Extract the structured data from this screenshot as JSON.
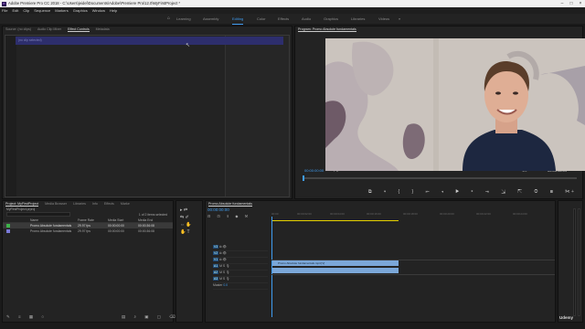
{
  "app": {
    "title": "Adobe Premiere Pro CC 2018 - C:\\Users\\jeidel\\Documents\\Adobe\\Premiere Pro\\12.0\\MyFirstProject *",
    "logo": "Pr"
  },
  "menu": [
    "File",
    "Edit",
    "Clip",
    "Sequence",
    "Markers",
    "Graphics",
    "Window",
    "Help"
  ],
  "workspaces": [
    "Learning",
    "Assembly",
    "Editing",
    "Color",
    "Effects",
    "Audio",
    "Graphics",
    "Libraries",
    "Videos"
  ],
  "active_workspace": "Editing",
  "source_tabs": [
    "Source: (no clips)",
    "Audio Clip Mixer",
    "Effect Controls",
    "Metadata"
  ],
  "effect_controls": {
    "header": "(no clip selected)"
  },
  "program": {
    "title": "Program: Promo Absolute fundamentals",
    "timecode_left": "00:00:00:00",
    "fit": "Fit",
    "timecode_right": "00:00:36:09",
    "ratio": "1/2"
  },
  "project": {
    "tabs": [
      "Project: MyFirstProject",
      "Media Browser",
      "Libraries",
      "Info",
      "Effects",
      "Marke"
    ],
    "file": "MyFirstProject.prproj",
    "items_selected": "1 of 2 items selected",
    "columns": [
      "Name",
      "Frame Rate",
      "Media Start",
      "Media End"
    ],
    "rows": [
      {
        "name": "Promo Absolute fundamentals",
        "rate": "29.97 fps",
        "start": "00:00:00:00",
        "end": "00:00:36:08"
      },
      {
        "name": "Promo Absolute fundamentals",
        "rate": "29.97 fps",
        "start": "00:00:00:00",
        "end": "00:00:36:08"
      }
    ]
  },
  "timeline": {
    "title": "Promo Absolute fundamentals",
    "timecode": "00:00:00:00",
    "ruler": [
      "00:00",
      "00:00:02:00",
      "00:00:04:00",
      "00:00:16:00",
      "00:00:18:00",
      "00:00:20:00",
      "00:00:22:00",
      "00:00:24:00"
    ],
    "video_tracks": [
      "V3",
      "V2",
      "V1"
    ],
    "audio_tracks": [
      "A1",
      "A2",
      "A3"
    ],
    "clip_video": "Promo Absolute fundamentals.mp4 [V]",
    "master": "Master",
    "master_val": "0.0"
  },
  "udemy": "Udemy"
}
